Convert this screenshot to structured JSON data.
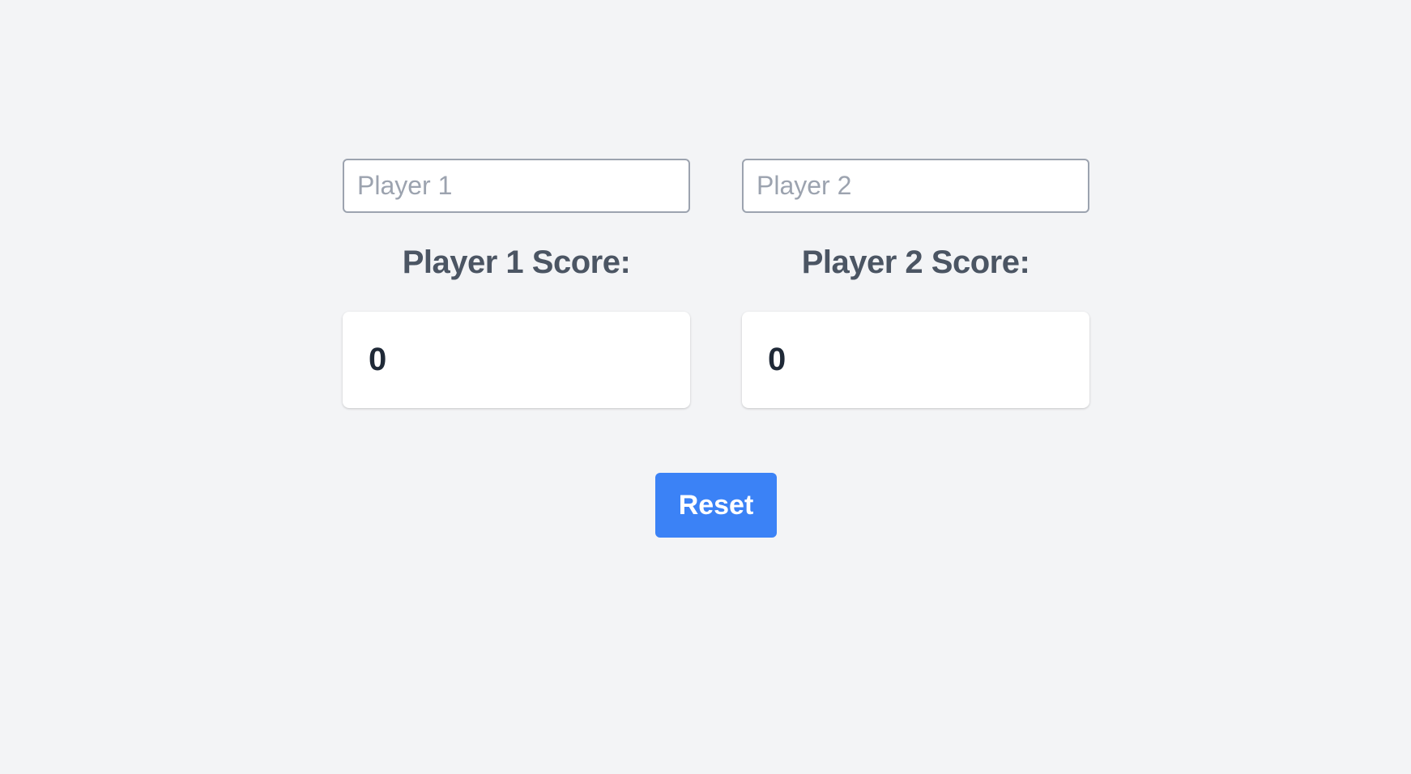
{
  "players": [
    {
      "input_placeholder": "Player 1",
      "input_value": "",
      "score_heading": "Player 1 Score:",
      "score": "0"
    },
    {
      "input_placeholder": "Player 2",
      "input_value": "",
      "score_heading": "Player 2 Score:",
      "score": "0"
    }
  ],
  "actions": {
    "reset_label": "Reset"
  },
  "colors": {
    "background": "#f3f4f6",
    "accent": "#3b82f6",
    "heading_text": "#4b5563",
    "score_text": "#1f2937",
    "input_border": "#9ca3af"
  }
}
